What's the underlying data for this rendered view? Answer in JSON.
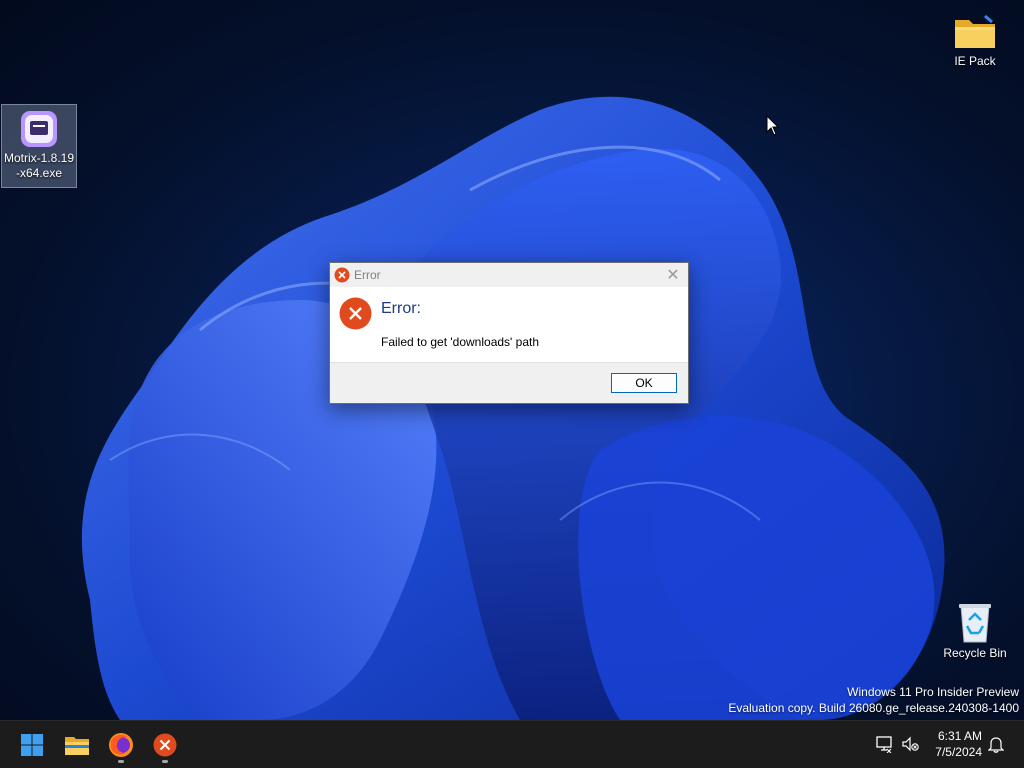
{
  "desktop": {
    "icons": [
      {
        "label": "Motrix-1.8.19-x64.exe",
        "icon": "motrix-app-icon",
        "selected": true
      },
      {
        "label": "IE Pack",
        "icon": "folder-icon"
      },
      {
        "label": "Recycle Bin",
        "icon": "recycle-bin-icon"
      }
    ],
    "watermark": {
      "line1": "Windows 11 Pro Insider Preview",
      "line2": "Evaluation copy. Build 26080.ge_release.240308-1400"
    }
  },
  "dialog": {
    "title": "Error",
    "heading": "Error:",
    "message": "Failed to get 'downloads' path",
    "ok_label": "OK",
    "close_glyph": "✕",
    "icon": "error-icon",
    "accent": "#e04a1f"
  },
  "taskbar": {
    "items": [
      {
        "name": "start-button",
        "icon": "windows-logo-icon"
      },
      {
        "name": "file-explorer",
        "icon": "folder-icon"
      },
      {
        "name": "firefox",
        "icon": "firefox-icon",
        "running": true
      },
      {
        "name": "error-app",
        "icon": "error-icon",
        "running": true
      }
    ],
    "clock": {
      "time": "6:31 AM",
      "date": "7/5/2024"
    },
    "tray": [
      "network-icon",
      "volume-muted-icon",
      "notification-bell-icon"
    ]
  },
  "colors": {
    "wallpaper_dark": "#04102b",
    "wallpaper_bloom": "#1f4fe0",
    "taskbar_bg": "#1c1c1c",
    "button_border": "#0067c0"
  }
}
